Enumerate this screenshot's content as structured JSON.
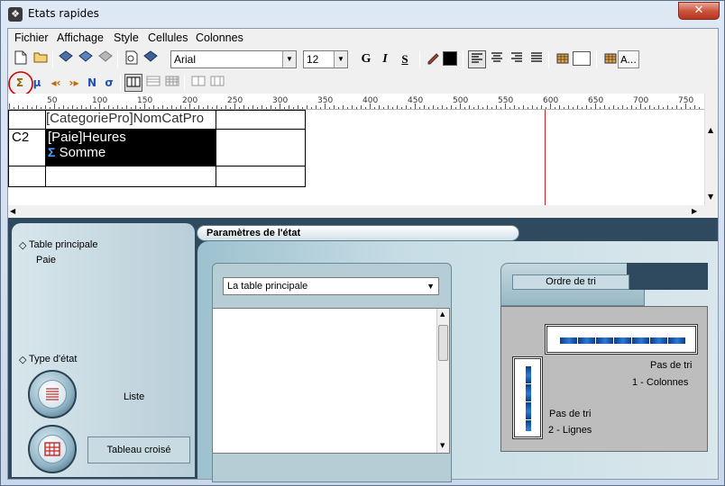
{
  "window": {
    "title": "Etats rapides",
    "close_glyph": "✕"
  },
  "menu": [
    "Fichier",
    "Affichage",
    "Style",
    "Cellules",
    "Colonnes"
  ],
  "toolbar": {
    "font_name": "Arial",
    "font_size": "12",
    "bold": "G",
    "italic": "I",
    "underline": "S",
    "text_color": "#000000",
    "highlight_color": "#ffffff",
    "font_button": "A..."
  },
  "ruler": {
    "labels": [
      "50",
      "100",
      "150",
      "200",
      "250",
      "300",
      "350",
      "400",
      "450",
      "500",
      "550",
      "600",
      "650",
      "700",
      "750"
    ]
  },
  "grid": {
    "header_cell": "[CategoriePro]NomCatPro",
    "row_label": "C2",
    "data_cell_line1": "[Paie]Heures",
    "data_cell_sigma": "Σ",
    "data_cell_line2": "Somme"
  },
  "left_panel": {
    "table_label": "Table principale",
    "table_value": "Paie",
    "type_label": "Type d'état",
    "option_list": "Liste",
    "option_crosstab": "Tableau croisé"
  },
  "params": {
    "title": "Paramètres de l'état",
    "table_select": "La table principale",
    "sort_tab": "Ordre de tri",
    "sort_cols_line1": "Pas de tri",
    "sort_cols_line2": "1 - Colonnes",
    "sort_rows_line1": "Pas de tri",
    "sort_rows_line2": "2 - Lignes"
  }
}
